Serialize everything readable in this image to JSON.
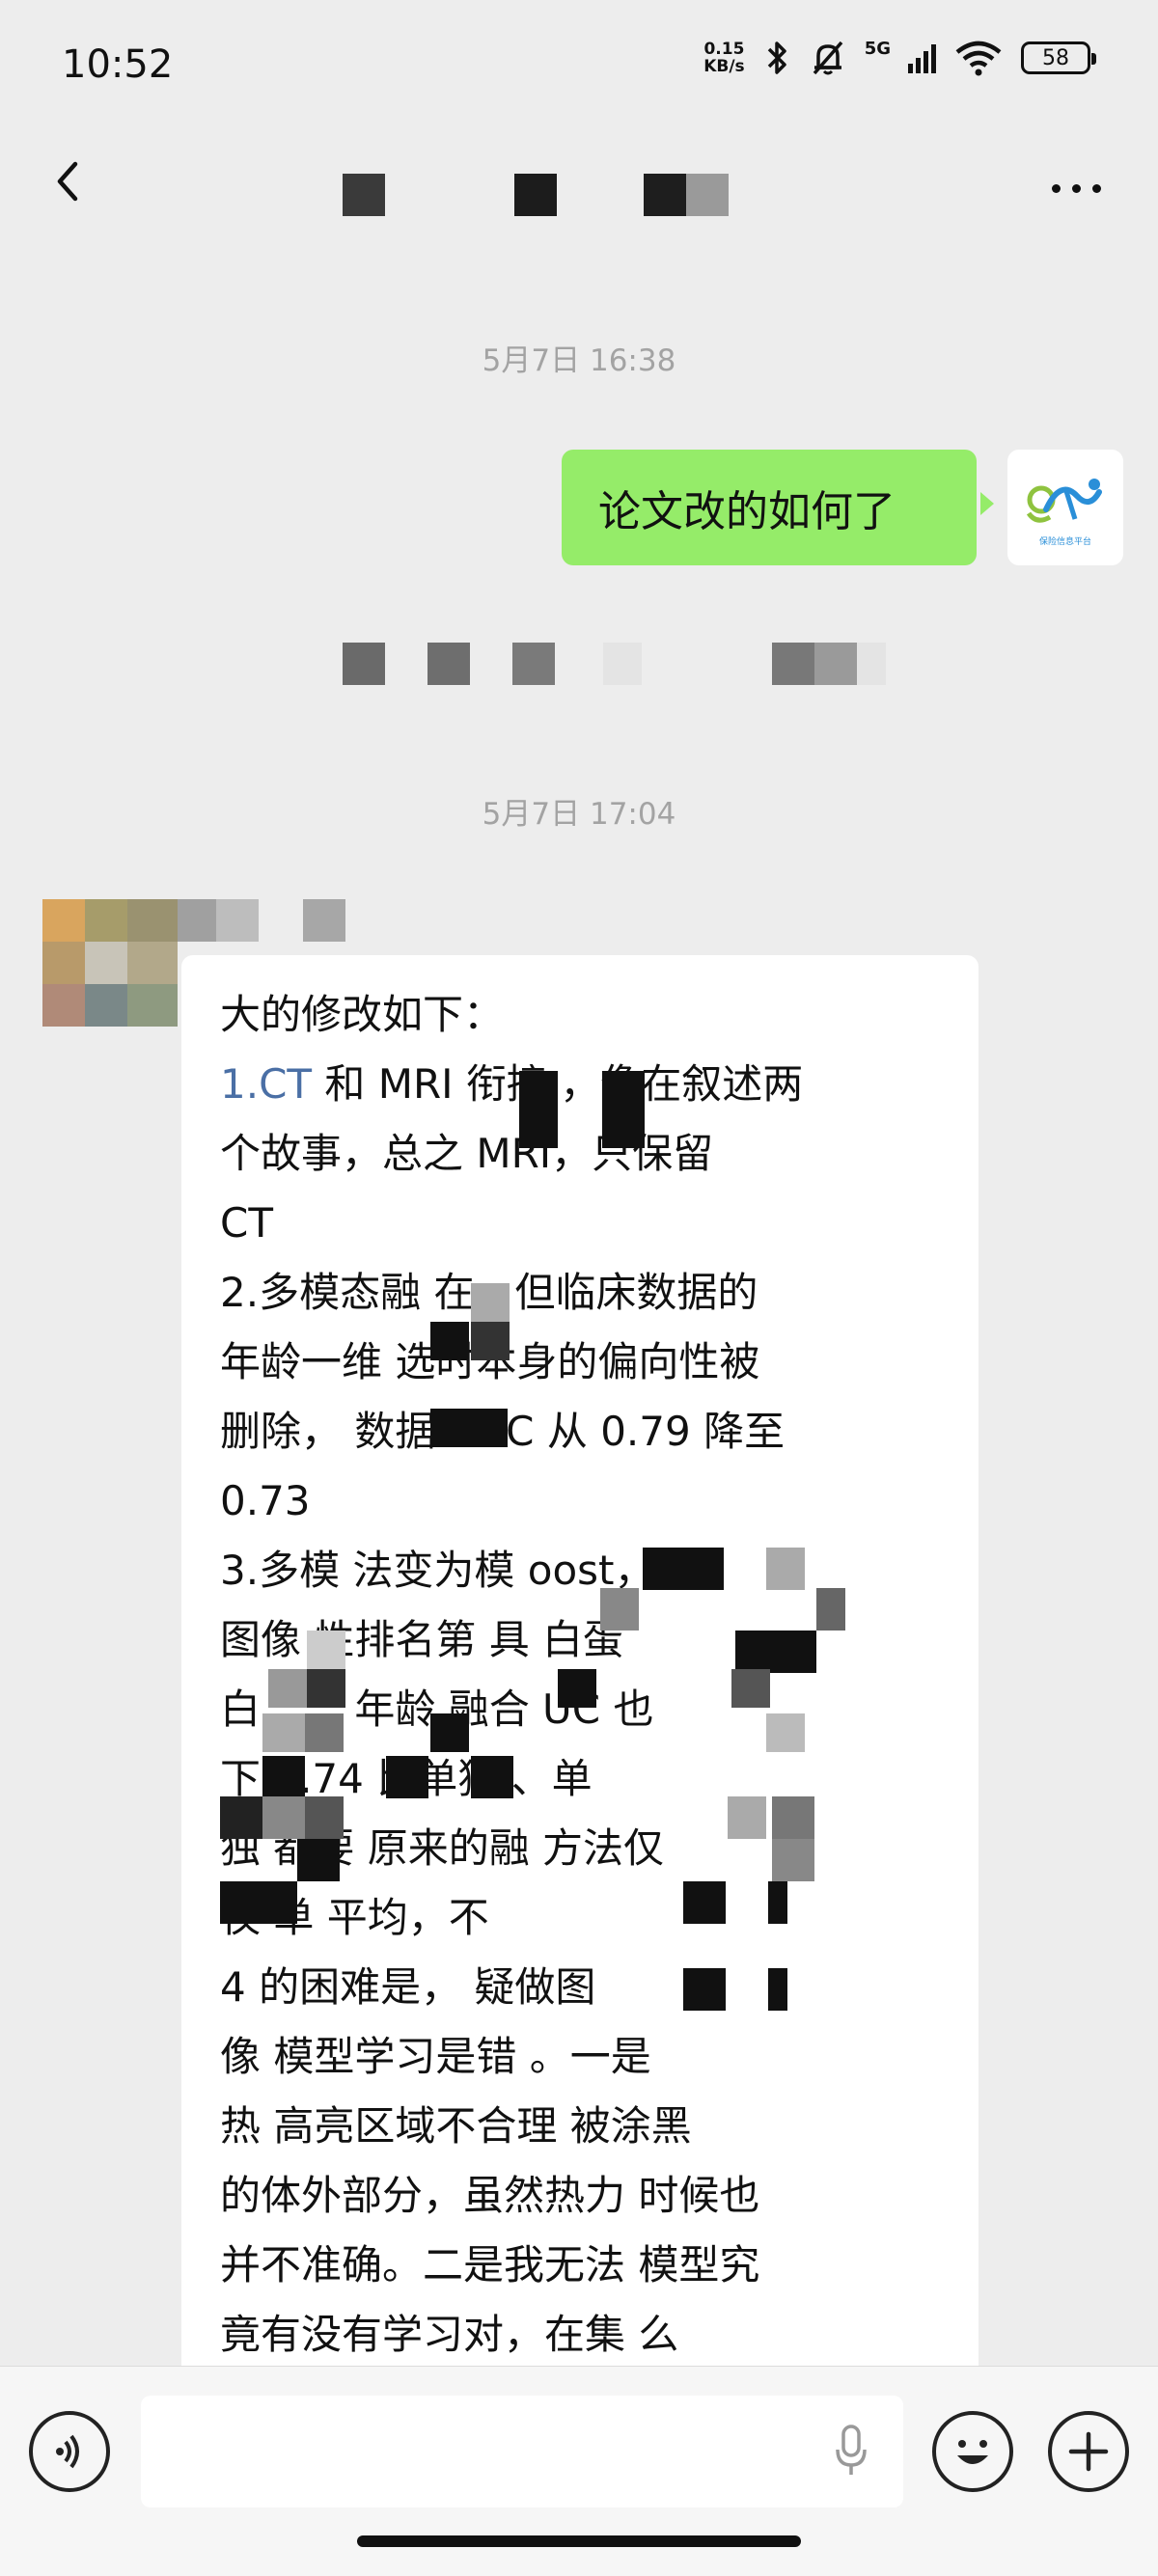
{
  "status_bar": {
    "time": "10:52",
    "net_speed_value": "0.15",
    "net_speed_unit": "KB/s",
    "network": "5G",
    "battery": "58",
    "icons": [
      "bluetooth-icon",
      "mute-bell-icon",
      "signal-icon",
      "wifi-icon",
      "battery-icon"
    ]
  },
  "header": {
    "back_icon": "chevron-left-icon",
    "more_icon": "more-dots-icon"
  },
  "messages": {
    "timestamp_1": "5月7日 16:38",
    "outgoing_text": "论文改的如何了",
    "outgoing_avatar_caption": "保险信息平台",
    "timestamp_2": "5月7日 17:04",
    "incoming_lines": [
      {
        "pre": "",
        "link": "",
        "text": "大的修改如下："
      },
      {
        "pre": "",
        "link": "1.CT",
        "text": " 和 MRI 衔接          ，像在叙述两"
      },
      {
        "pre": "",
        "link": "",
        "text": "个故事，总之          MRI，只保留"
      },
      {
        "pre": "",
        "link": "",
        "text": "CT"
      },
      {
        "pre": "",
        "link": "",
        "text": "2.多模态融       在，但临床数据的"
      },
      {
        "pre": "",
        "link": "",
        "text": "年龄一维         选时本身的偏向性被"
      },
      {
        "pre": "",
        "link": "",
        "text": "删除，         数据 AUC 从 0.79 降至"
      },
      {
        "pre": "",
        "link": "",
        "text": "0.73"
      },
      {
        "pre": "",
        "link": "",
        "text": "3.多模      法变为模                oost，"
      },
      {
        "pre": "",
        "link": "",
        "text": "图像        性排名第       具        白蛋"
      },
      {
        "pre": "",
        "link": "",
        "text": "白、      、年龄       融合           UC 也"
      },
      {
        "pre": "",
        "link": "",
        "text": "下        0.74        比单独          、单"
      },
      {
        "pre": "",
        "link": "",
        "text": "独          都要      原来的融       方法仅"
      },
      {
        "pre": "",
        "link": "",
        "text": "仅         单        平均，不"
      },
      {
        "pre": "",
        "link": "",
        "text": "4         的困难是，         疑做图"
      },
      {
        "pre": "",
        "link": "",
        "text": "像         模型学习是错         。一是"
      },
      {
        "pre": "",
        "link": "",
        "text": "热        高亮区域不合理        被涂黑"
      },
      {
        "pre": "",
        "link": "",
        "text": "的体外部分，虽然热力           时候也"
      },
      {
        "pre": "",
        "link": "",
        "text": "并不准确。二是我无法           模型究"
      },
      {
        "pre": "",
        "link": "",
        "text": "竟有没有学习对，在集         么"
      }
    ]
  },
  "input_bar": {
    "voice_icon": "voice-icon",
    "mic_icon": "mic-icon",
    "emoji_icon": "emoji-icon",
    "plus_icon": "plus-icon",
    "input_value": ""
  },
  "colors": {
    "background": "#ededed",
    "outgoing_bubble": "#95ec69",
    "incoming_bubble": "#ffffff",
    "link": "#4a6fa5",
    "timestamp": "#a3a3a3"
  }
}
